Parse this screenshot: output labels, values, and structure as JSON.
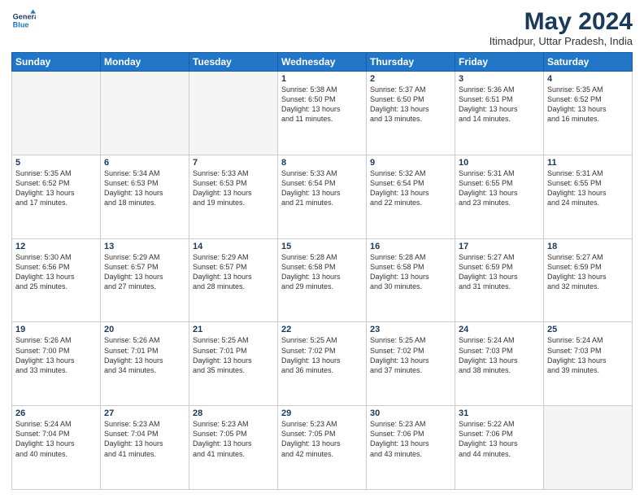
{
  "header": {
    "logo_line1": "General",
    "logo_line2": "Blue",
    "title": "May 2024",
    "subtitle": "Itimadpur, Uttar Pradesh, India"
  },
  "days_of_week": [
    "Sunday",
    "Monday",
    "Tuesday",
    "Wednesday",
    "Thursday",
    "Friday",
    "Saturday"
  ],
  "weeks": [
    [
      {
        "day": "",
        "info": ""
      },
      {
        "day": "",
        "info": ""
      },
      {
        "day": "",
        "info": ""
      },
      {
        "day": "1",
        "info": "Sunrise: 5:38 AM\nSunset: 6:50 PM\nDaylight: 13 hours\nand 11 minutes."
      },
      {
        "day": "2",
        "info": "Sunrise: 5:37 AM\nSunset: 6:50 PM\nDaylight: 13 hours\nand 13 minutes."
      },
      {
        "day": "3",
        "info": "Sunrise: 5:36 AM\nSunset: 6:51 PM\nDaylight: 13 hours\nand 14 minutes."
      },
      {
        "day": "4",
        "info": "Sunrise: 5:35 AM\nSunset: 6:52 PM\nDaylight: 13 hours\nand 16 minutes."
      }
    ],
    [
      {
        "day": "5",
        "info": "Sunrise: 5:35 AM\nSunset: 6:52 PM\nDaylight: 13 hours\nand 17 minutes."
      },
      {
        "day": "6",
        "info": "Sunrise: 5:34 AM\nSunset: 6:53 PM\nDaylight: 13 hours\nand 18 minutes."
      },
      {
        "day": "7",
        "info": "Sunrise: 5:33 AM\nSunset: 6:53 PM\nDaylight: 13 hours\nand 19 minutes."
      },
      {
        "day": "8",
        "info": "Sunrise: 5:33 AM\nSunset: 6:54 PM\nDaylight: 13 hours\nand 21 minutes."
      },
      {
        "day": "9",
        "info": "Sunrise: 5:32 AM\nSunset: 6:54 PM\nDaylight: 13 hours\nand 22 minutes."
      },
      {
        "day": "10",
        "info": "Sunrise: 5:31 AM\nSunset: 6:55 PM\nDaylight: 13 hours\nand 23 minutes."
      },
      {
        "day": "11",
        "info": "Sunrise: 5:31 AM\nSunset: 6:55 PM\nDaylight: 13 hours\nand 24 minutes."
      }
    ],
    [
      {
        "day": "12",
        "info": "Sunrise: 5:30 AM\nSunset: 6:56 PM\nDaylight: 13 hours\nand 25 minutes."
      },
      {
        "day": "13",
        "info": "Sunrise: 5:29 AM\nSunset: 6:57 PM\nDaylight: 13 hours\nand 27 minutes."
      },
      {
        "day": "14",
        "info": "Sunrise: 5:29 AM\nSunset: 6:57 PM\nDaylight: 13 hours\nand 28 minutes."
      },
      {
        "day": "15",
        "info": "Sunrise: 5:28 AM\nSunset: 6:58 PM\nDaylight: 13 hours\nand 29 minutes."
      },
      {
        "day": "16",
        "info": "Sunrise: 5:28 AM\nSunset: 6:58 PM\nDaylight: 13 hours\nand 30 minutes."
      },
      {
        "day": "17",
        "info": "Sunrise: 5:27 AM\nSunset: 6:59 PM\nDaylight: 13 hours\nand 31 minutes."
      },
      {
        "day": "18",
        "info": "Sunrise: 5:27 AM\nSunset: 6:59 PM\nDaylight: 13 hours\nand 32 minutes."
      }
    ],
    [
      {
        "day": "19",
        "info": "Sunrise: 5:26 AM\nSunset: 7:00 PM\nDaylight: 13 hours\nand 33 minutes."
      },
      {
        "day": "20",
        "info": "Sunrise: 5:26 AM\nSunset: 7:01 PM\nDaylight: 13 hours\nand 34 minutes."
      },
      {
        "day": "21",
        "info": "Sunrise: 5:25 AM\nSunset: 7:01 PM\nDaylight: 13 hours\nand 35 minutes."
      },
      {
        "day": "22",
        "info": "Sunrise: 5:25 AM\nSunset: 7:02 PM\nDaylight: 13 hours\nand 36 minutes."
      },
      {
        "day": "23",
        "info": "Sunrise: 5:25 AM\nSunset: 7:02 PM\nDaylight: 13 hours\nand 37 minutes."
      },
      {
        "day": "24",
        "info": "Sunrise: 5:24 AM\nSunset: 7:03 PM\nDaylight: 13 hours\nand 38 minutes."
      },
      {
        "day": "25",
        "info": "Sunrise: 5:24 AM\nSunset: 7:03 PM\nDaylight: 13 hours\nand 39 minutes."
      }
    ],
    [
      {
        "day": "26",
        "info": "Sunrise: 5:24 AM\nSunset: 7:04 PM\nDaylight: 13 hours\nand 40 minutes."
      },
      {
        "day": "27",
        "info": "Sunrise: 5:23 AM\nSunset: 7:04 PM\nDaylight: 13 hours\nand 41 minutes."
      },
      {
        "day": "28",
        "info": "Sunrise: 5:23 AM\nSunset: 7:05 PM\nDaylight: 13 hours\nand 41 minutes."
      },
      {
        "day": "29",
        "info": "Sunrise: 5:23 AM\nSunset: 7:05 PM\nDaylight: 13 hours\nand 42 minutes."
      },
      {
        "day": "30",
        "info": "Sunrise: 5:23 AM\nSunset: 7:06 PM\nDaylight: 13 hours\nand 43 minutes."
      },
      {
        "day": "31",
        "info": "Sunrise: 5:22 AM\nSunset: 7:06 PM\nDaylight: 13 hours\nand 44 minutes."
      },
      {
        "day": "",
        "info": ""
      }
    ]
  ]
}
